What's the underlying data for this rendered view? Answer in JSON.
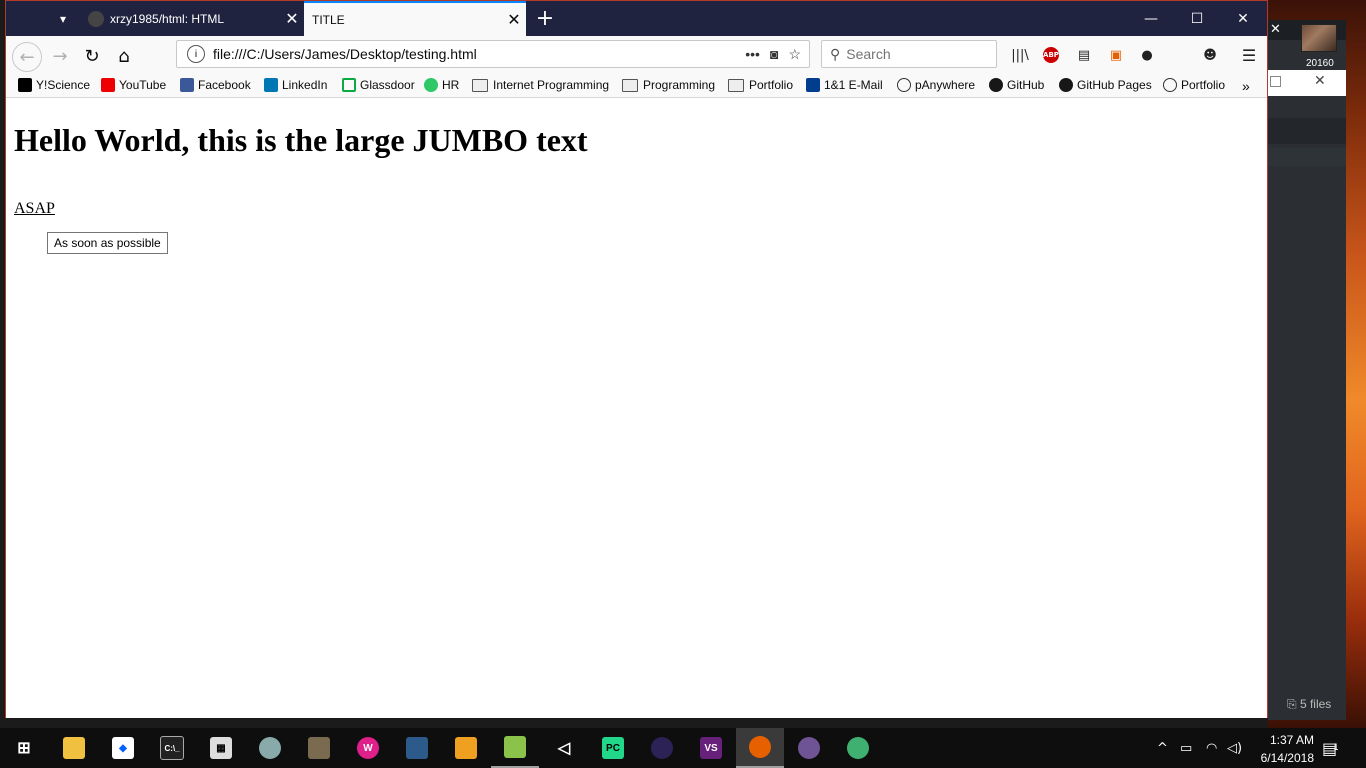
{
  "desktop": {
    "thumbnail_label": "20160",
    "files_label": "5 files"
  },
  "browser": {
    "tabs": [
      {
        "label": "xrzy1985/html: HTML",
        "active": false
      },
      {
        "label": "TITLE",
        "active": true
      }
    ],
    "url": "file:///C:/Users/James/Desktop/testing.html",
    "search_placeholder": "Search",
    "bookmarks": [
      {
        "label": "Y!Science",
        "icon": "y-science-icon"
      },
      {
        "label": "YouTube",
        "icon": "youtube-icon"
      },
      {
        "label": "Facebook",
        "icon": "facebook-icon"
      },
      {
        "label": "LinkedIn",
        "icon": "linkedin-icon"
      },
      {
        "label": "Glassdoor",
        "icon": "glassdoor-icon"
      },
      {
        "label": "HR",
        "icon": "hackerrank-icon"
      },
      {
        "label": "Internet Programming",
        "icon": "folder-icon"
      },
      {
        "label": "Programming",
        "icon": "folder-icon"
      },
      {
        "label": "Portfolio",
        "icon": "folder-icon"
      },
      {
        "label": "1&1 E-Mail",
        "icon": "1and1-icon"
      },
      {
        "label": "pAnywhere",
        "icon": "panywhere-icon"
      },
      {
        "label": "GitHub",
        "icon": "github-icon"
      },
      {
        "label": "GitHub Pages",
        "icon": "github-icon"
      },
      {
        "label": "Portfolio",
        "icon": "globe-icon"
      }
    ],
    "abp_label": "ABP"
  },
  "page": {
    "heading": "Hello World, this is the large JUMBO text",
    "abbr_text": "ASAP",
    "tooltip": "As soon as possible"
  },
  "taskbar": {
    "time": "1:37 AM",
    "date": "6/14/2018",
    "notification_count": "1"
  }
}
